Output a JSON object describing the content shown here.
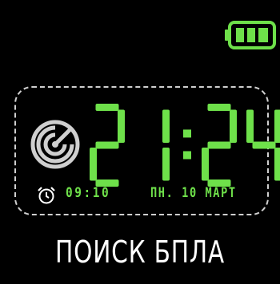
{
  "battery": {
    "level_bars": 3,
    "max_bars": 3,
    "color": "#6ee04a"
  },
  "clock": {
    "time": "21:24",
    "color": "#6ee04a"
  },
  "alarm": {
    "icon": "alarm-clock-icon",
    "time": "09:10"
  },
  "date": {
    "text": "ПН. 10 МАРТ"
  },
  "radar": {
    "icon": "radar-icon"
  },
  "status": {
    "text": "ПОИСК БПЛА"
  }
}
